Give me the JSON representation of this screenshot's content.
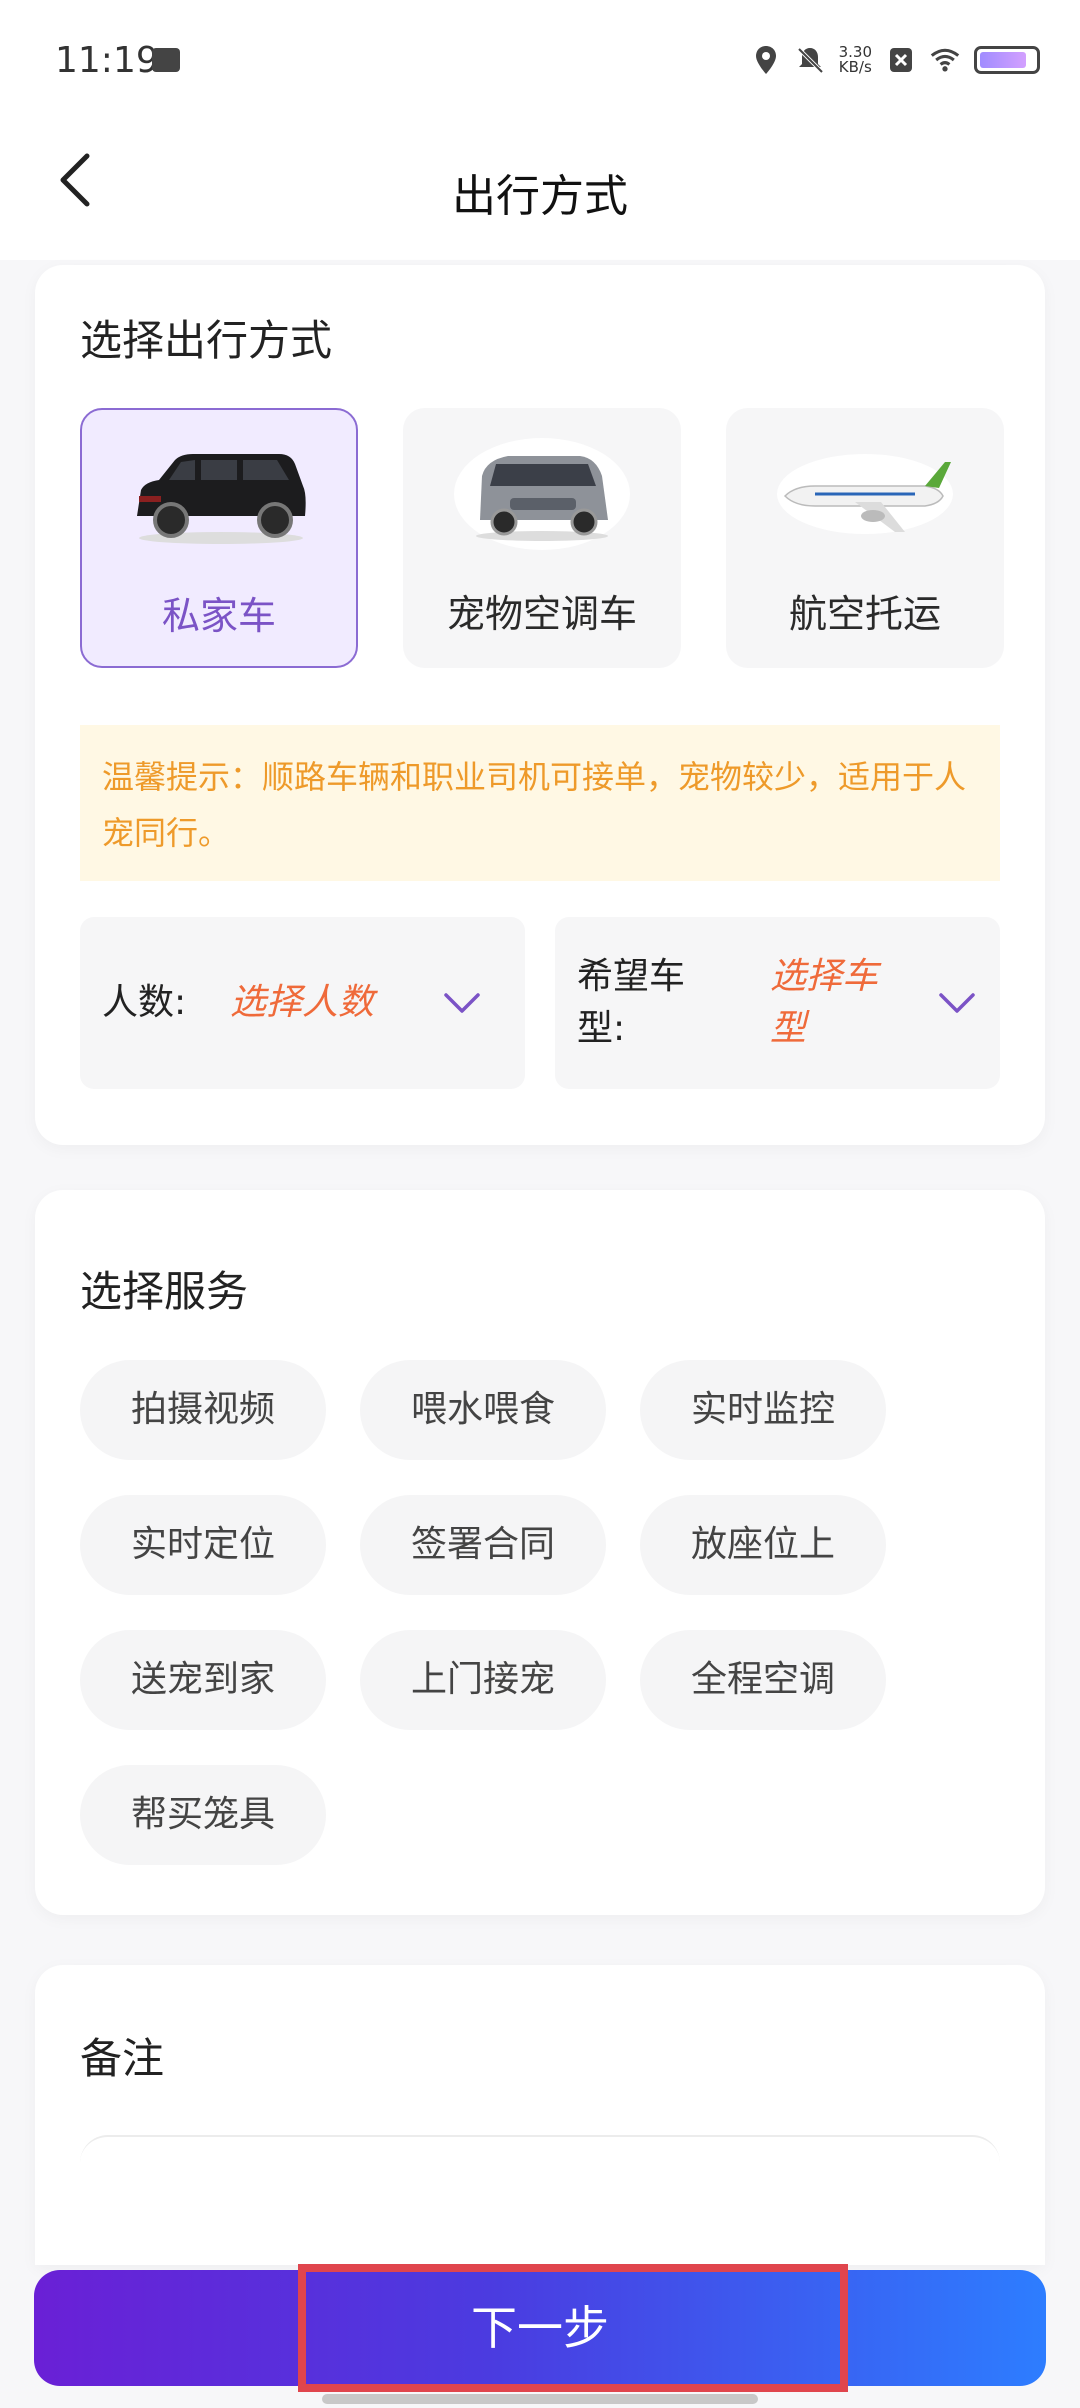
{
  "status_bar": {
    "time": "11:19",
    "net_speed_value": "3.30",
    "net_speed_unit": "KB/s"
  },
  "header": {
    "title": "出行方式"
  },
  "travel": {
    "section_title": "选择出行方式",
    "options": [
      {
        "label": "私家车",
        "selected": true
      },
      {
        "label": "宠物空调车",
        "selected": false
      },
      {
        "label": "航空托运",
        "selected": false
      }
    ],
    "tip": "温馨提示：顺路车辆和职业司机可接单，宠物较少，适用于人宠同行。",
    "people": {
      "label": "人数:",
      "value": "选择人数"
    },
    "car_type": {
      "label_line1": "希望车",
      "label_line2": "型:",
      "value_line1": "选择车",
      "value_line2": "型"
    }
  },
  "services": {
    "section_title": "选择服务",
    "items": [
      "拍摄视频",
      "喂水喂食",
      "实时监控",
      "实时定位",
      "签署合同",
      "放座位上",
      "送宠到家",
      "上门接宠",
      "全程空调",
      "帮买笼具"
    ]
  },
  "note": {
    "section_title": "备注"
  },
  "footer": {
    "next_label": "下一步"
  },
  "colors": {
    "accent_purple": "#7b53c6",
    "tip_text": "#ee9a2a",
    "placeholder_orange": "#ef6a3a",
    "button_gradient_start": "#6a20d6",
    "button_gradient_end": "#2d7dff",
    "highlight_red": "#e0454d"
  }
}
